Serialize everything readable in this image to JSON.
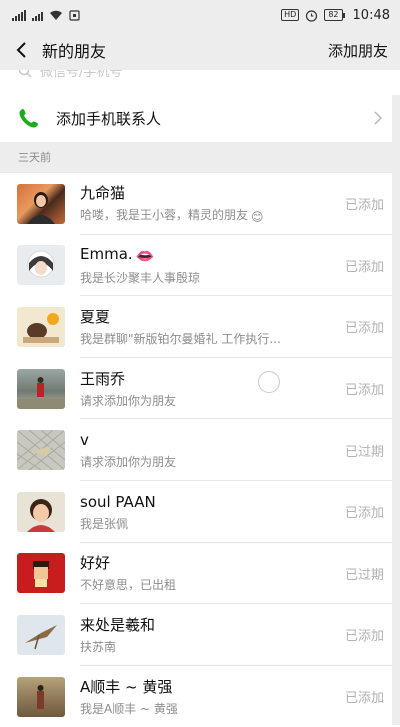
{
  "status_bar": {
    "carrier_icons": "signal-wifi",
    "hd_badge": "HD",
    "battery": "82",
    "time": "10:48"
  },
  "nav": {
    "title": "新的朋友",
    "action": "添加朋友"
  },
  "search": {
    "placeholder": "微信号/手机号"
  },
  "phone_contacts": {
    "label": "添加手机联系人"
  },
  "section": {
    "header": "三天前"
  },
  "requests": [
    {
      "name": "九命猫",
      "message": "哈喽，我是王小蓉，精灵的朋友",
      "status": "已添加",
      "emoji": "😊"
    },
    {
      "name": "Emma.",
      "message": "我是长沙聚丰人事殷琼",
      "status": "已添加",
      "emoji": "👄"
    },
    {
      "name": "夏夏",
      "message": "我是群聊\"新版铂尔曼婚礼 工作执行...",
      "status": "已添加"
    },
    {
      "name": "王雨乔",
      "message": "请求添加你为朋友",
      "status": "已添加"
    },
    {
      "name": "v",
      "message": "请求添加你为朋友",
      "status": "已过期"
    },
    {
      "name": "soul PAAN",
      "message": "我是张佩",
      "status": "已添加"
    },
    {
      "name": "好好",
      "message": "不好意思，已出租",
      "status": "已过期"
    },
    {
      "name": "来处是羲和",
      "message": "扶苏南",
      "status": "已添加"
    },
    {
      "name": "A顺丰 ~ 黄强",
      "message": "我是A顺丰 ~ 黄强",
      "status": "已添加"
    }
  ],
  "colors": {
    "background": "#ededed",
    "phone_icon": "#1aad19",
    "status_text": "#b2b2b2"
  }
}
